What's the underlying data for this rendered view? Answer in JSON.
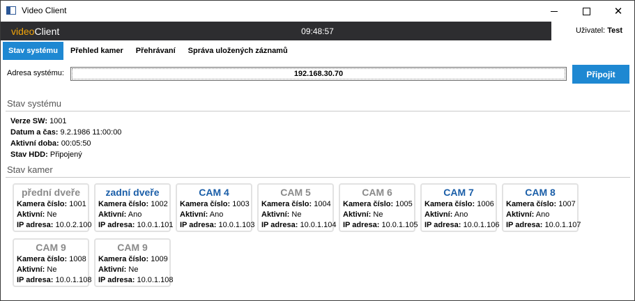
{
  "window": {
    "title": "Video Client"
  },
  "appbar": {
    "brand_part1": "video",
    "brand_part2": "Client",
    "clock": "09:48:57",
    "user_label": "Uživatel:",
    "user_name": "Test"
  },
  "tabs": [
    {
      "label": "Stav systému",
      "active": true
    },
    {
      "label": "Přehled kamer",
      "active": false
    },
    {
      "label": "Přehrávaní",
      "active": false
    },
    {
      "label": "Správa uložených záznamů",
      "active": false
    }
  ],
  "address": {
    "label": "Adresa systému:",
    "value": "192.168.30.70",
    "connect_label": "Připojit"
  },
  "system": {
    "heading": "Stav systému",
    "rows": [
      {
        "key": "Verze SW:",
        "value": "1001"
      },
      {
        "key": "Datum a čas:",
        "value": "9.2.1986 11:00:00"
      },
      {
        "key": "Aktivní doba:",
        "value": "00:05:50"
      },
      {
        "key": "Stav HDD:",
        "value": "Připojený"
      }
    ]
  },
  "cameras": {
    "heading": "Stav kamer",
    "label_number": "Kamera číslo:",
    "label_active": "Aktivní:",
    "label_ip": "IP adresa:",
    "items": [
      {
        "name": "přední dveře",
        "number": "1001",
        "active": "Ne",
        "ip": "10.0.2.100",
        "online": false
      },
      {
        "name": "zadní dveře",
        "number": "1002",
        "active": "Ano",
        "ip": "10.0.1.101",
        "online": true
      },
      {
        "name": "CAM 4",
        "number": "1003",
        "active": "Ano",
        "ip": "10.0.1.103",
        "online": true
      },
      {
        "name": "CAM 5",
        "number": "1004",
        "active": "Ne",
        "ip": "10.0.1.104",
        "online": false
      },
      {
        "name": "CAM 6",
        "number": "1005",
        "active": "Ne",
        "ip": "10.0.1.105",
        "online": false
      },
      {
        "name": "CAM 7",
        "number": "1006",
        "active": "Ano",
        "ip": "10.0.1.106",
        "online": true
      },
      {
        "name": "CAM 8",
        "number": "1007",
        "active": "Ano",
        "ip": "10.0.1.107",
        "online": true
      },
      {
        "name": "CAM 9",
        "number": "1008",
        "active": "Ne",
        "ip": "10.0.1.108",
        "online": false
      },
      {
        "name": "CAM 9",
        "number": "1009",
        "active": "Ne",
        "ip": "10.0.1.108",
        "online": false
      }
    ]
  },
  "colors": {
    "accent": "#1e88d2",
    "brand": "#f0a30a",
    "online": "#1a5ea8",
    "offline": "#8a8a8a",
    "appbar": "#2d2d30"
  }
}
